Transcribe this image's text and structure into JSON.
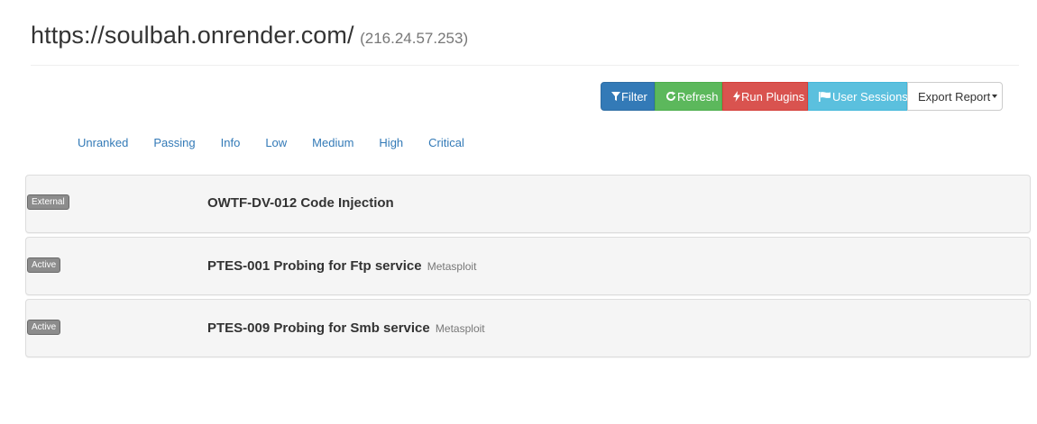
{
  "header": {
    "url": "https://soulbah.onrender.com/",
    "ip": "(216.24.57.253)"
  },
  "toolbar": {
    "filter_label": "Filter",
    "refresh_label": "Refresh",
    "run_plugins_label": "Run Plugins",
    "user_sessions_label": "User Sessions",
    "export_report_label": "Export Report",
    "colors": {
      "filter": "#337ab7",
      "refresh": "#5cb85c",
      "run_plugins": "#d9534f",
      "user_sessions": "#5bc0de"
    },
    "icons": {
      "filter": "filter-icon",
      "refresh": "refresh-icon",
      "run_plugins": "flash-icon",
      "user_sessions": "flag-icon"
    }
  },
  "ranks": [
    "Unranked",
    "Passing",
    "Info",
    "Low",
    "Medium",
    "High",
    "Critical"
  ],
  "plugins": [
    {
      "type": "External",
      "title": "OWTF-DV-012 Code Injection",
      "subtitle": ""
    },
    {
      "type": "Active",
      "title": "PTES-001 Probing for Ftp service",
      "subtitle": "Metasploit"
    },
    {
      "type": "Active",
      "title": "PTES-009 Probing for Smb service",
      "subtitle": "Metasploit"
    }
  ]
}
